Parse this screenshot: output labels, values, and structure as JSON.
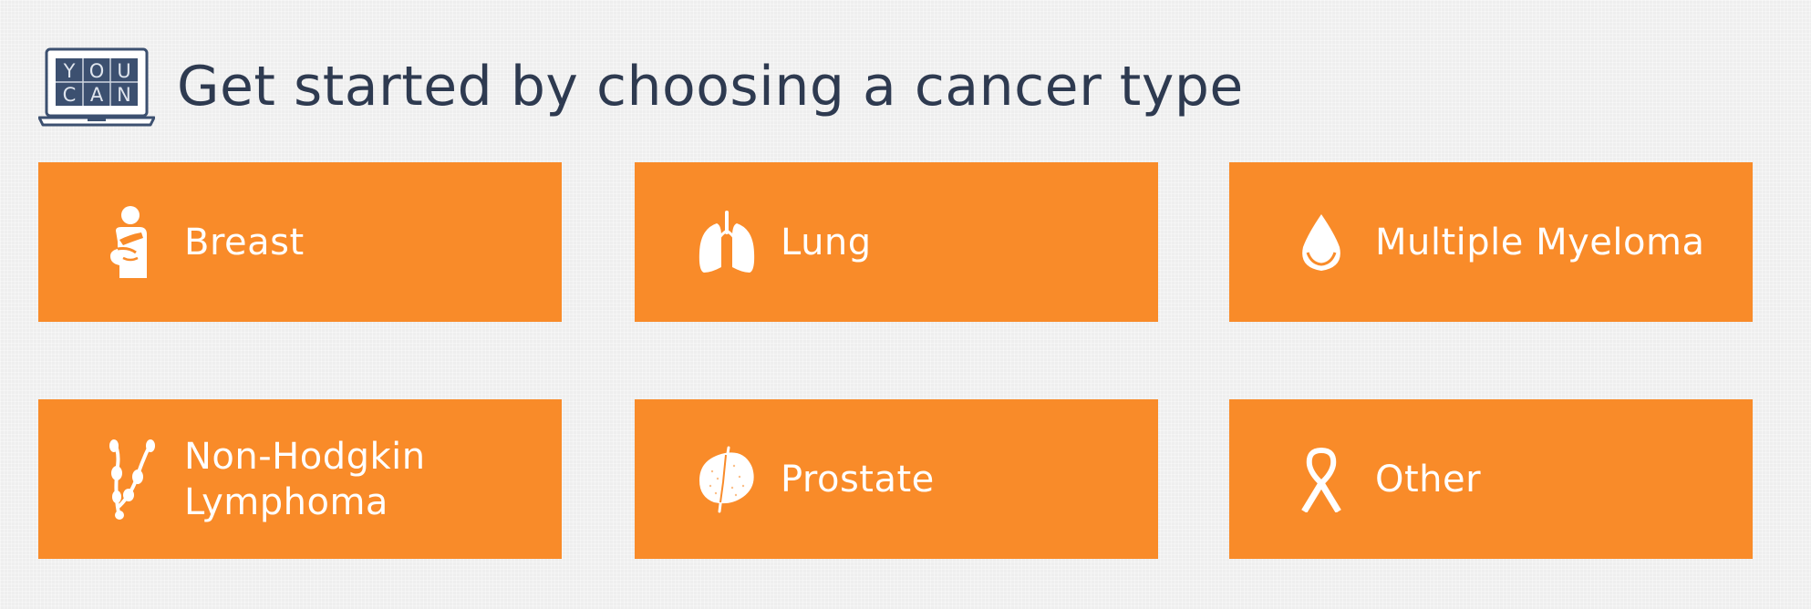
{
  "header": {
    "logo_text": [
      "Y",
      "O",
      "U",
      "C",
      "A",
      "N"
    ],
    "title": "Get started by choosing a cancer type"
  },
  "tiles": [
    {
      "label": "Breast",
      "icon": "breast-exam-icon"
    },
    {
      "label": "Lung",
      "icon": "lungs-icon"
    },
    {
      "label": "Multiple Myeloma",
      "icon": "blood-drop-icon"
    },
    {
      "label_lines": [
        "Non-Hodgkin",
        "Lymphoma"
      ],
      "icon": "lymph-nodes-icon"
    },
    {
      "label": "Prostate",
      "icon": "prostate-icon"
    },
    {
      "label": "Other",
      "icon": "awareness-ribbon-icon"
    }
  ],
  "colors": {
    "tile": "#f98b29",
    "title": "#2e3a50",
    "background": "#eeeeee",
    "logo_frame": "#3c5070"
  }
}
